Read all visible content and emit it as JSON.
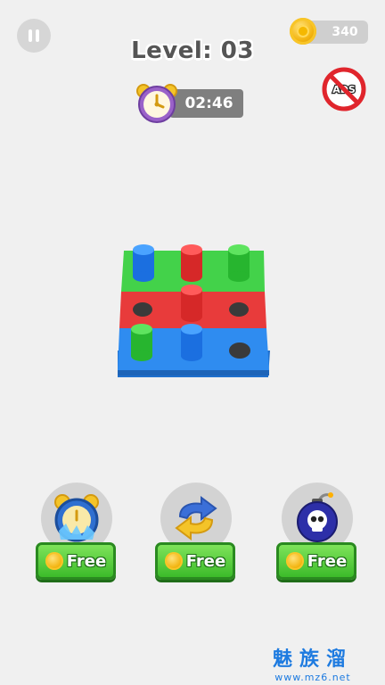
{
  "header": {
    "level_label": "Level: 03",
    "coins": "340",
    "timer": "02:46",
    "no_ads_label": "ADS"
  },
  "board": {
    "rows": [
      "green",
      "red",
      "blue"
    ],
    "colors": {
      "green": "#43d24a",
      "red": "#e83b3b",
      "blue": "#2f8cf0"
    }
  },
  "boosters": [
    {
      "name": "freeze-time",
      "button_label": "Free"
    },
    {
      "name": "shuffle",
      "button_label": "Free"
    },
    {
      "name": "bomb",
      "button_label": "Free"
    }
  ],
  "watermark": {
    "name": "魅族溜",
    "url": "www.mz6.net"
  }
}
